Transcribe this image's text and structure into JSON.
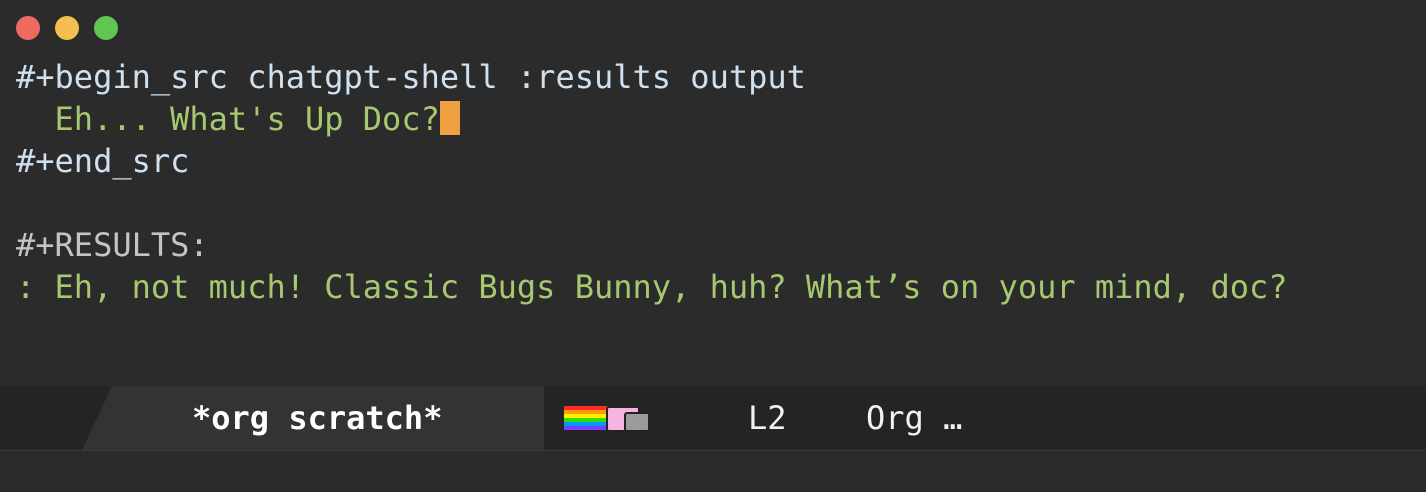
{
  "window": {
    "controls": {
      "close_color": "#ed6a5e",
      "minimize_color": "#f4bf4f",
      "zoom_color": "#61c554"
    }
  },
  "editor": {
    "lines": [
      {
        "text": "#+begin_src chatgpt-shell :results output",
        "style": "keyword"
      },
      {
        "text": "  Eh... What's Up Doc?",
        "style": "source"
      },
      {
        "text": "#+end_src",
        "style": "keyword"
      },
      {
        "text": "",
        "style": "blank"
      },
      {
        "text": "#+RESULTS:",
        "style": "results-keyword"
      },
      {
        "text": ": Eh, not much! Classic Bugs Bunny, huh? What’s on your mind, doc?",
        "style": "results"
      }
    ],
    "cursor_color": "#f0a040"
  },
  "modeline": {
    "buffer_name": "*org scratch*",
    "position_icon": "nyan-cat-icon",
    "line": "L2",
    "mode": "Org …"
  }
}
